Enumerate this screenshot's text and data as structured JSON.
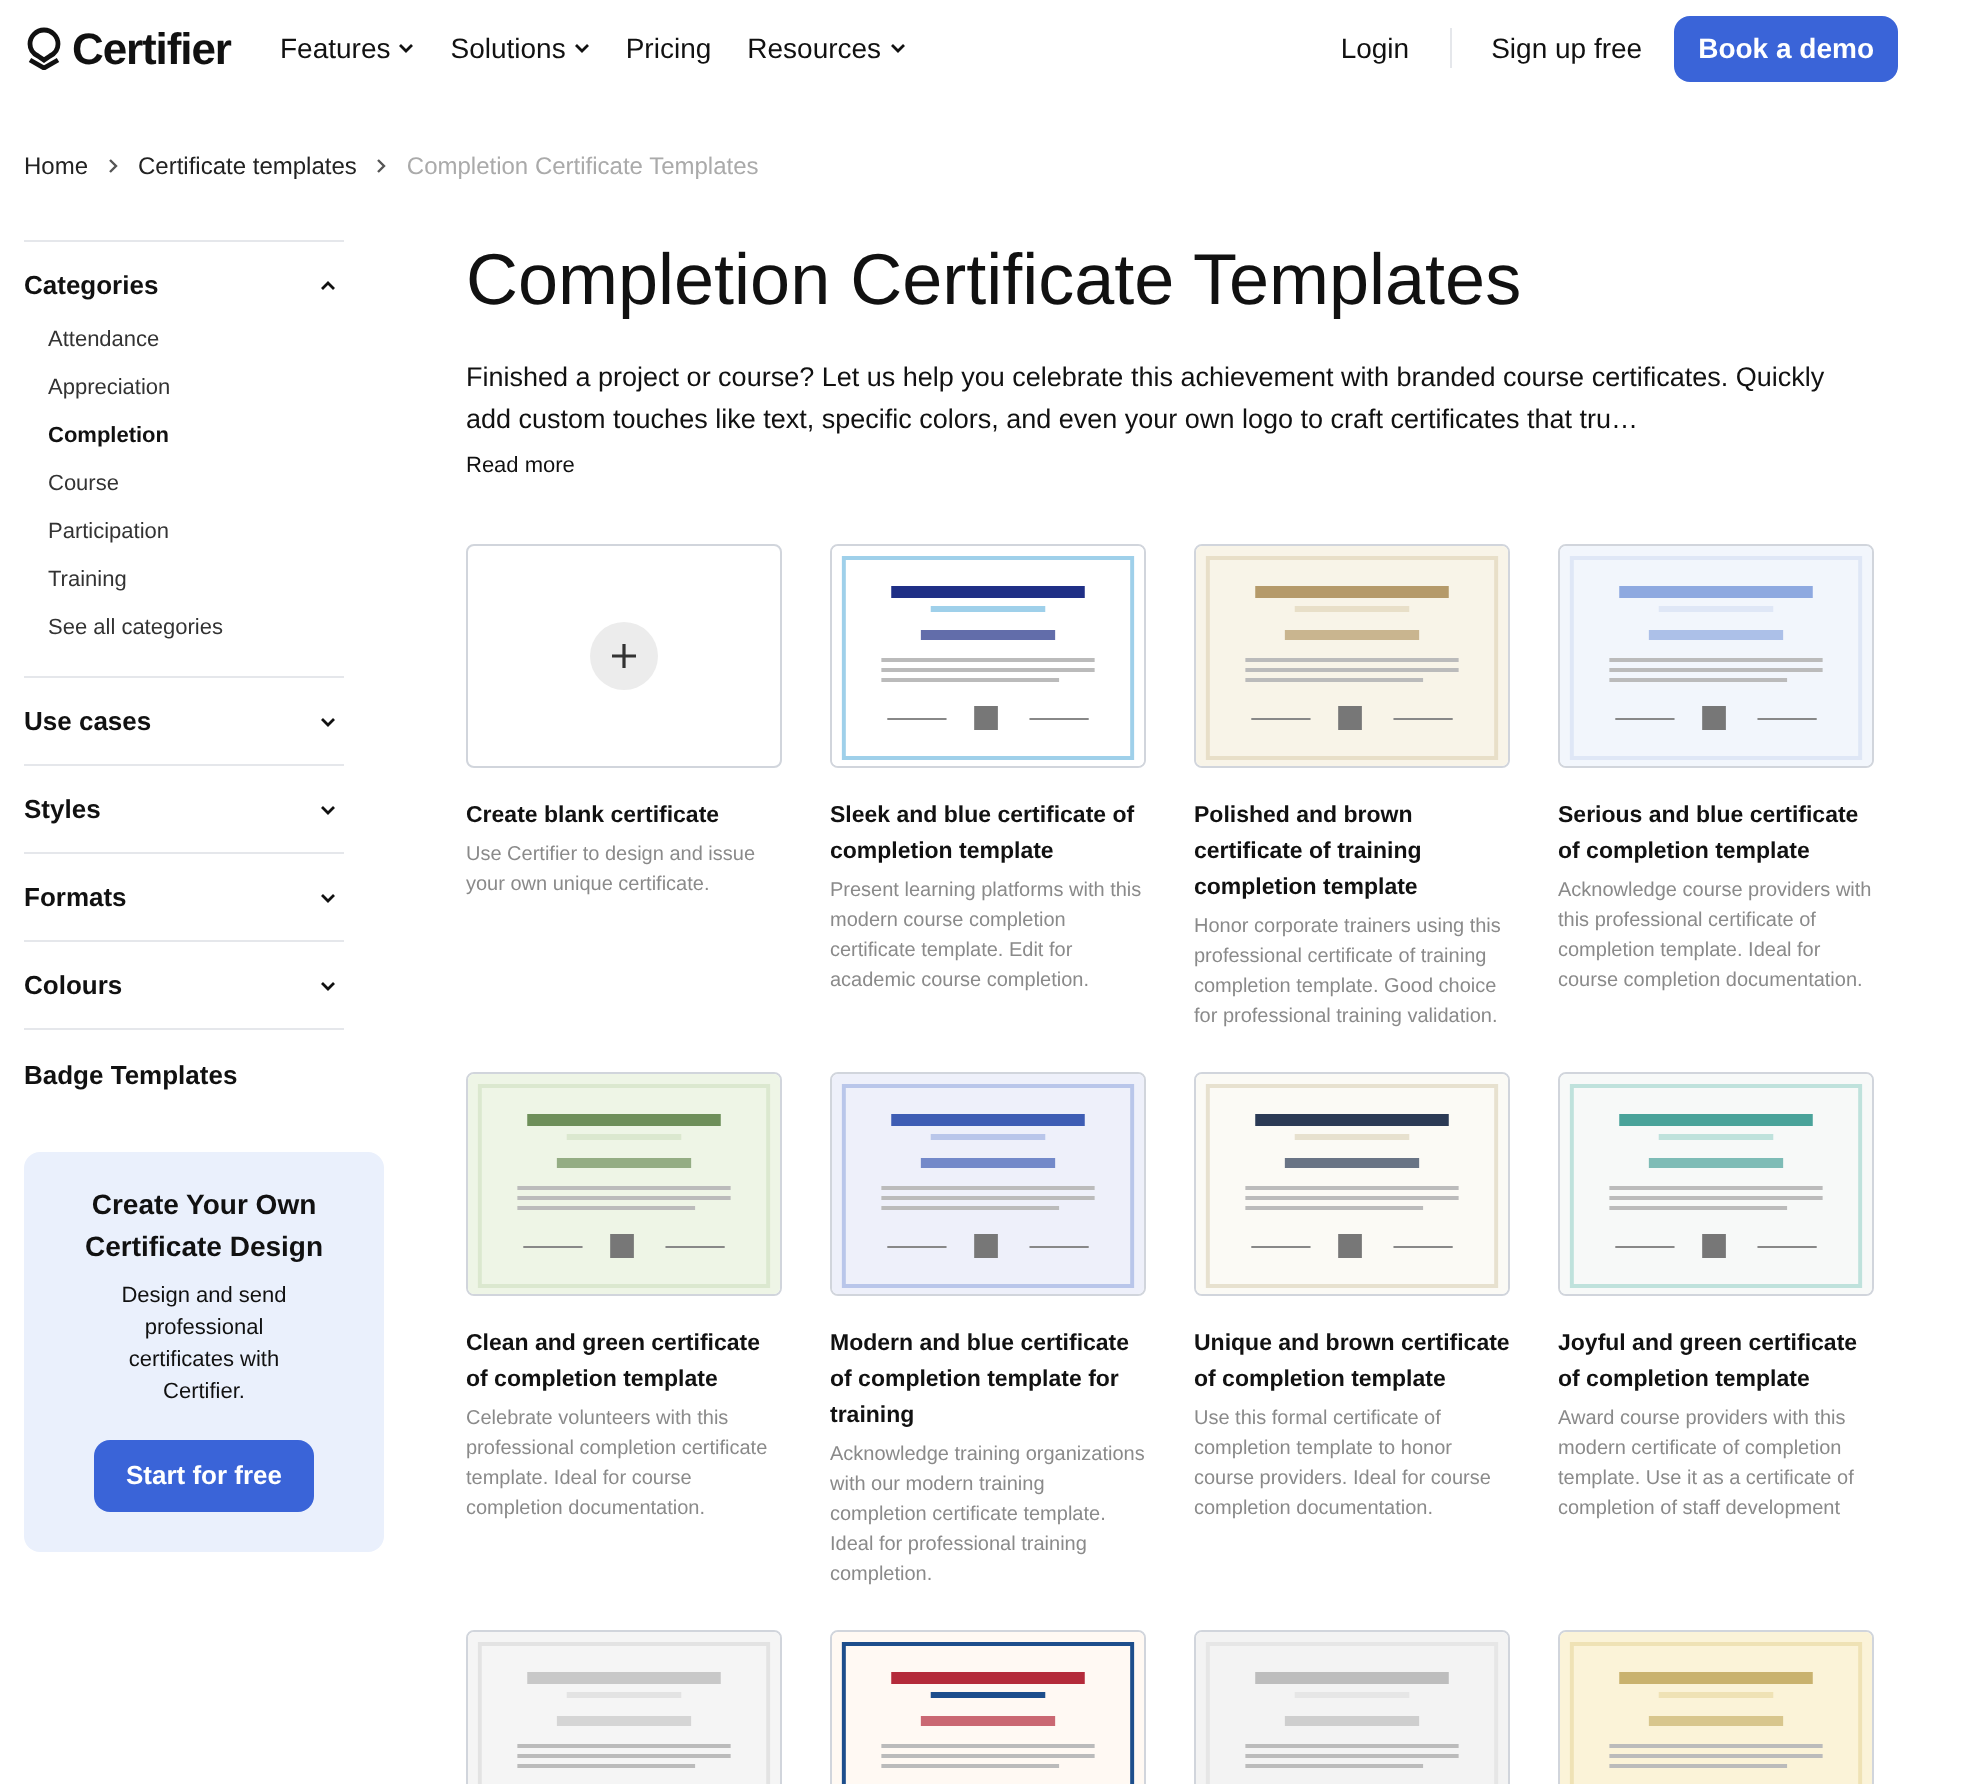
{
  "header": {
    "logo": "Certifier",
    "nav": [
      {
        "label": "Features",
        "dropdown": true
      },
      {
        "label": "Solutions",
        "dropdown": true
      },
      {
        "label": "Pricing",
        "dropdown": false
      },
      {
        "label": "Resources",
        "dropdown": true
      }
    ],
    "login": "Login",
    "signup": "Sign up free",
    "demo": "Book a demo"
  },
  "breadcrumb": [
    {
      "label": "Home",
      "current": false
    },
    {
      "label": "Certificate templates",
      "current": false
    },
    {
      "label": "Completion Certificate Templates",
      "current": true
    }
  ],
  "sidebar": {
    "sections": [
      {
        "label": "Categories",
        "expanded": true,
        "items": [
          {
            "label": "Attendance",
            "selected": false
          },
          {
            "label": "Appreciation",
            "selected": false
          },
          {
            "label": "Completion",
            "selected": true
          },
          {
            "label": "Course",
            "selected": false
          },
          {
            "label": "Participation",
            "selected": false
          },
          {
            "label": "Training",
            "selected": false
          },
          {
            "label": "See all categories",
            "selected": false
          }
        ]
      },
      {
        "label": "Use cases",
        "expanded": false
      },
      {
        "label": "Styles",
        "expanded": false
      },
      {
        "label": "Formats",
        "expanded": false
      },
      {
        "label": "Colours",
        "expanded": false
      }
    ],
    "badge_templates": "Badge Templates",
    "promo": {
      "title": "Create Your Own Certificate Design",
      "text": "Design and send professional certificates with Certifier.",
      "button": "Start for free"
    }
  },
  "main": {
    "title": "Completion Certificate Templates",
    "intro": "Finished a project or course? Let us help you celebrate this achievement with branded course certificates. Quickly add custom touches like text, specific colors, and even your own logo to craft certificates that tru…",
    "read_more": "Read more",
    "cards": [
      {
        "kind": "blank",
        "title": "Create blank certificate",
        "description": "Use Certifier to design and issue your own unique certificate."
      },
      {
        "kind": "template",
        "title": "Sleek and blue certificate of completion template",
        "description": "Present learning platforms with this modern course completion certificate template. Edit for academic course completion."
      },
      {
        "kind": "template",
        "title": "Polished and brown certificate of training completion template",
        "description": "Honor corporate trainers using this professional certificate of training completion template. Good choice for professional training validation."
      },
      {
        "kind": "template",
        "title": "Serious and blue certificate of completion template",
        "description": "Acknowledge course providers with this professional certificate of completion template. Ideal for course completion documentation."
      },
      {
        "kind": "template",
        "title": "Clean and green certificate of completion template",
        "description": "Celebrate volunteers with this professional completion certificate template. Ideal for course completion documentation."
      },
      {
        "kind": "template",
        "title": "Modern and blue certificate of completion template for training",
        "description": "Acknowledge training organizations with our modern training completion certificate template. Ideal for professional training completion."
      },
      {
        "kind": "template",
        "title": "Unique and brown certificate of completion template",
        "description": "Use this formal certificate of completion template to honor course providers. Ideal for course completion documentation."
      },
      {
        "kind": "template",
        "title": "Joyful and green certificate of completion template",
        "description": "Award course providers with this modern certificate of completion template. Use it as a certificate of completion of staff development"
      },
      {
        "kind": "template"
      },
      {
        "kind": "template"
      },
      {
        "kind": "template"
      },
      {
        "kind": "template"
      }
    ]
  }
}
